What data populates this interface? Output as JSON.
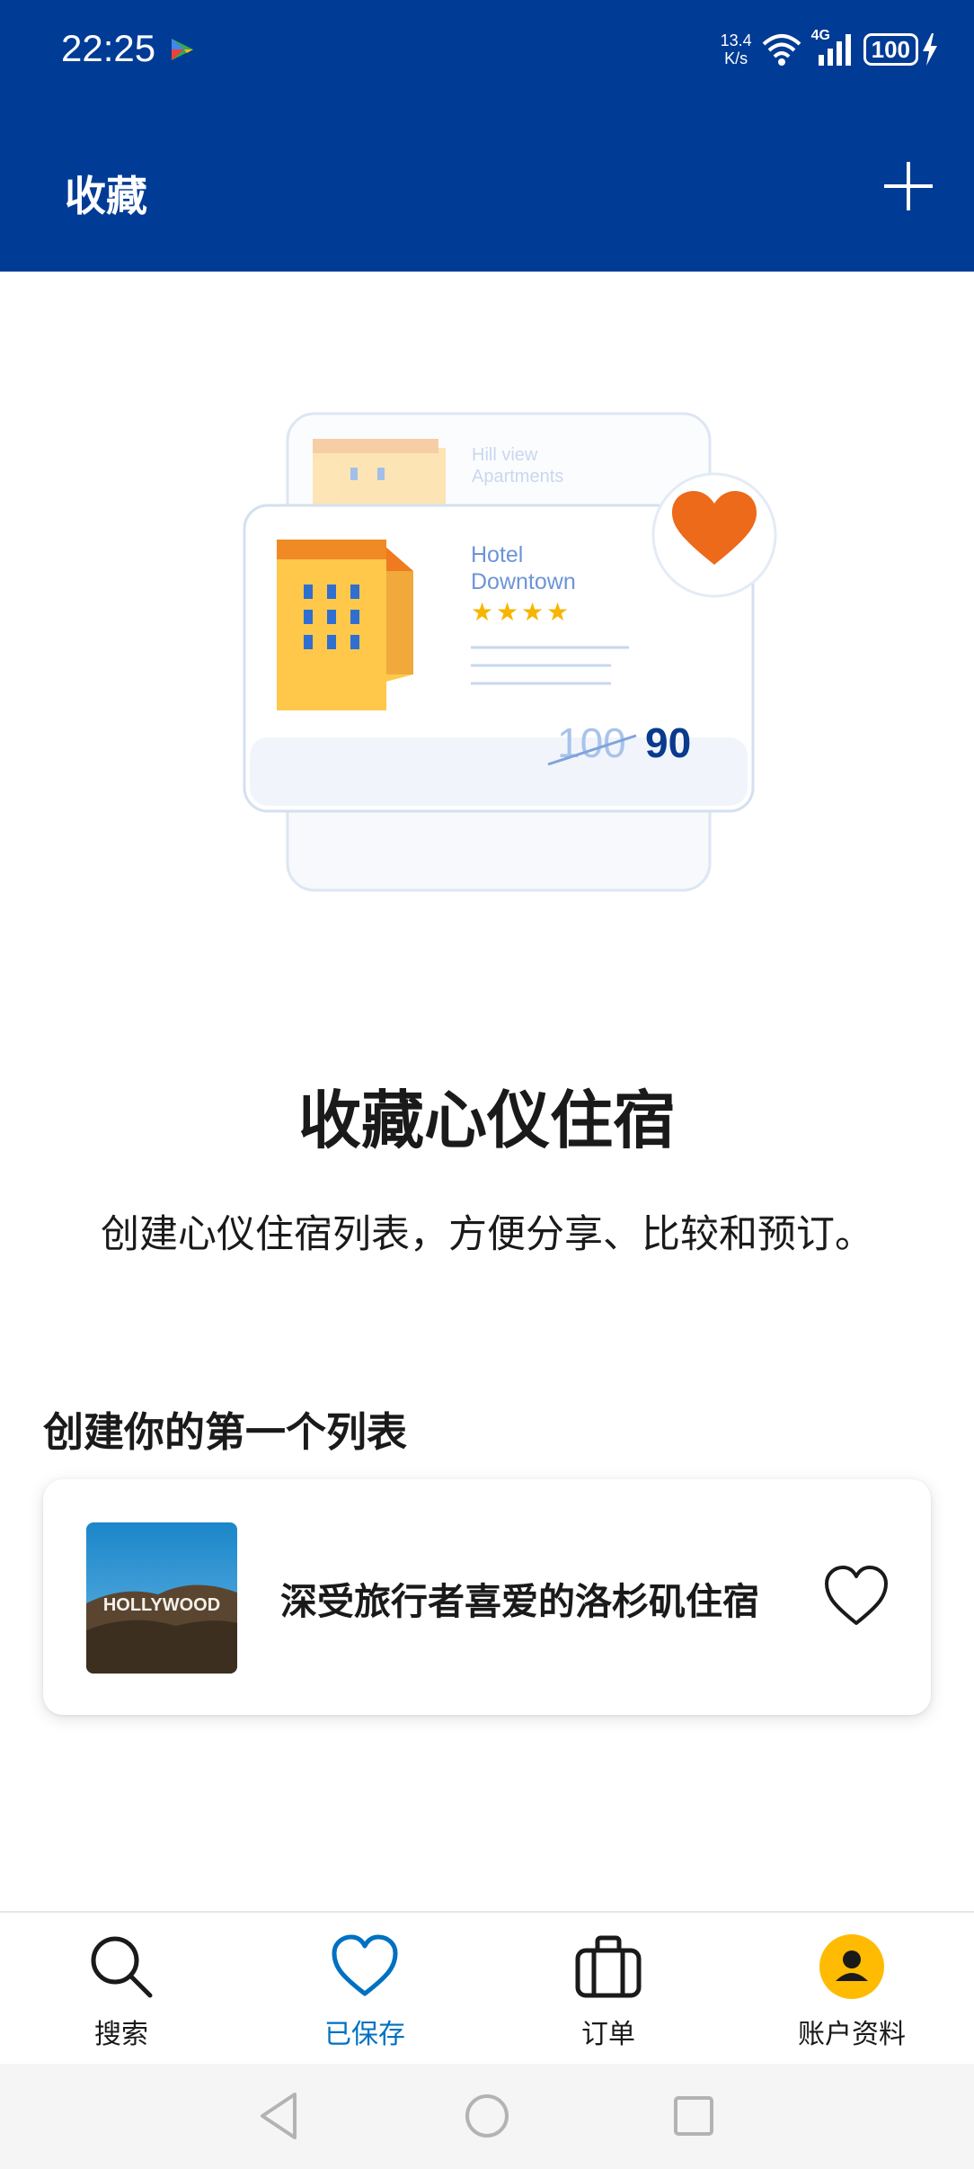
{
  "status_bar": {
    "time": "22:25",
    "net_speed_value": "13.4",
    "net_speed_unit": "K/s",
    "network": "4G",
    "battery": "100"
  },
  "header": {
    "title": "收藏",
    "add_icon": "plus-icon"
  },
  "illustration": {
    "back_card_title_line1": "Hill view",
    "back_card_title_line2": "Apartments",
    "front_card_title_line1": "Hotel",
    "front_card_title_line2": "Downtown",
    "old_price": "100",
    "new_price": "90",
    "rating": 4
  },
  "empty_state": {
    "headline": "收藏心仪住宿",
    "subtitle": "创建心仪住宿列表，方便分享、比较和预订。"
  },
  "section": {
    "title": "创建你的第一个列表"
  },
  "suggested_list": {
    "title": "深受旅行者喜爱的洛杉矶住宿",
    "thumb_text": "HOLLYWOOD"
  },
  "bottom_nav": {
    "items": [
      {
        "label": "搜索",
        "icon": "search-icon"
      },
      {
        "label": "已保存",
        "icon": "heart-icon"
      },
      {
        "label": "订单",
        "icon": "briefcase-icon"
      },
      {
        "label": "账户资料",
        "icon": "account-icon"
      }
    ],
    "active_index": 1
  },
  "colors": {
    "brand_blue": "#003b95",
    "active_blue": "#0071c2",
    "accent_yellow": "#febb02",
    "heart_orange": "#e8590c"
  }
}
